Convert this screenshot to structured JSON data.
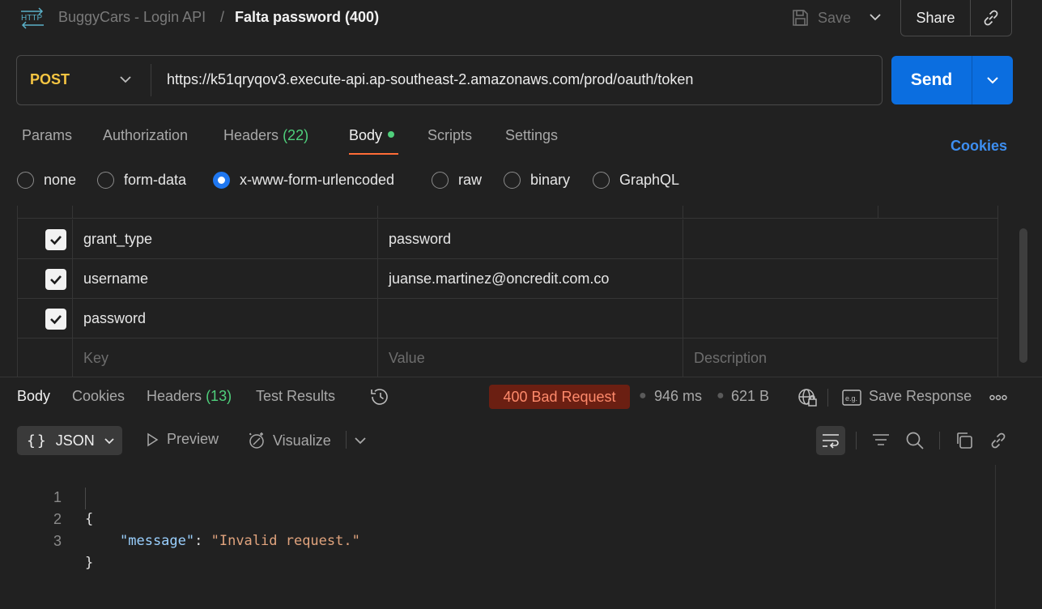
{
  "header": {
    "protocol_icon": "http-icon",
    "collection": "BuggyCars - Login API",
    "separator": "/",
    "request_title": "Falta password (400)",
    "save_label": "Save",
    "share_label": "Share"
  },
  "request": {
    "method": "POST",
    "url": "https://k51qryqov3.execute-api.ap-southeast-2.amazonaws.com/prod/oauth/token",
    "send_label": "Send"
  },
  "tabs": {
    "params": "Params",
    "authorization": "Authorization",
    "headers": "Headers",
    "headers_count": "(22)",
    "body": "Body",
    "scripts": "Scripts",
    "settings": "Settings",
    "cookies": "Cookies"
  },
  "body_types": {
    "none": "none",
    "form_data": "form-data",
    "urlencoded": "x-www-form-urlencoded",
    "raw": "raw",
    "binary": "binary",
    "graphql": "GraphQL",
    "selected": "x-www-form-urlencoded"
  },
  "params_table": {
    "rows": [
      {
        "key": "grant_type",
        "value": "password",
        "checked": true
      },
      {
        "key": "username",
        "value": "juanse.martinez@oncredit.com.co",
        "checked": true
      },
      {
        "key": "password",
        "value": "",
        "checked": true
      }
    ],
    "placeholders": {
      "key": "Key",
      "value": "Value",
      "description": "Description"
    }
  },
  "response": {
    "tabs": {
      "body": "Body",
      "cookies": "Cookies",
      "headers": "Headers",
      "headers_count": "(13)",
      "test_results": "Test Results"
    },
    "status": "400 Bad Request",
    "time": "946 ms",
    "size": "621 B",
    "save_response": "Save Response",
    "format": "JSON",
    "preview": "Preview",
    "visualize": "Visualize",
    "code_lines": [
      {
        "n": "1",
        "open": "{"
      },
      {
        "n": "2",
        "key": "\"message\"",
        "colon": ": ",
        "value": "\"Invalid request.\""
      },
      {
        "n": "3",
        "close": "}"
      }
    ]
  },
  "colors": {
    "background": "#212121",
    "accent_send": "#0b6ee0",
    "method_post": "#f5c542",
    "tab_active_underline": "#ff6c37",
    "status_error_bg": "#6b1f12",
    "status_error_text": "#ff8a6b",
    "count_green": "#4fcf7b",
    "link_blue": "#3d8ef0"
  }
}
